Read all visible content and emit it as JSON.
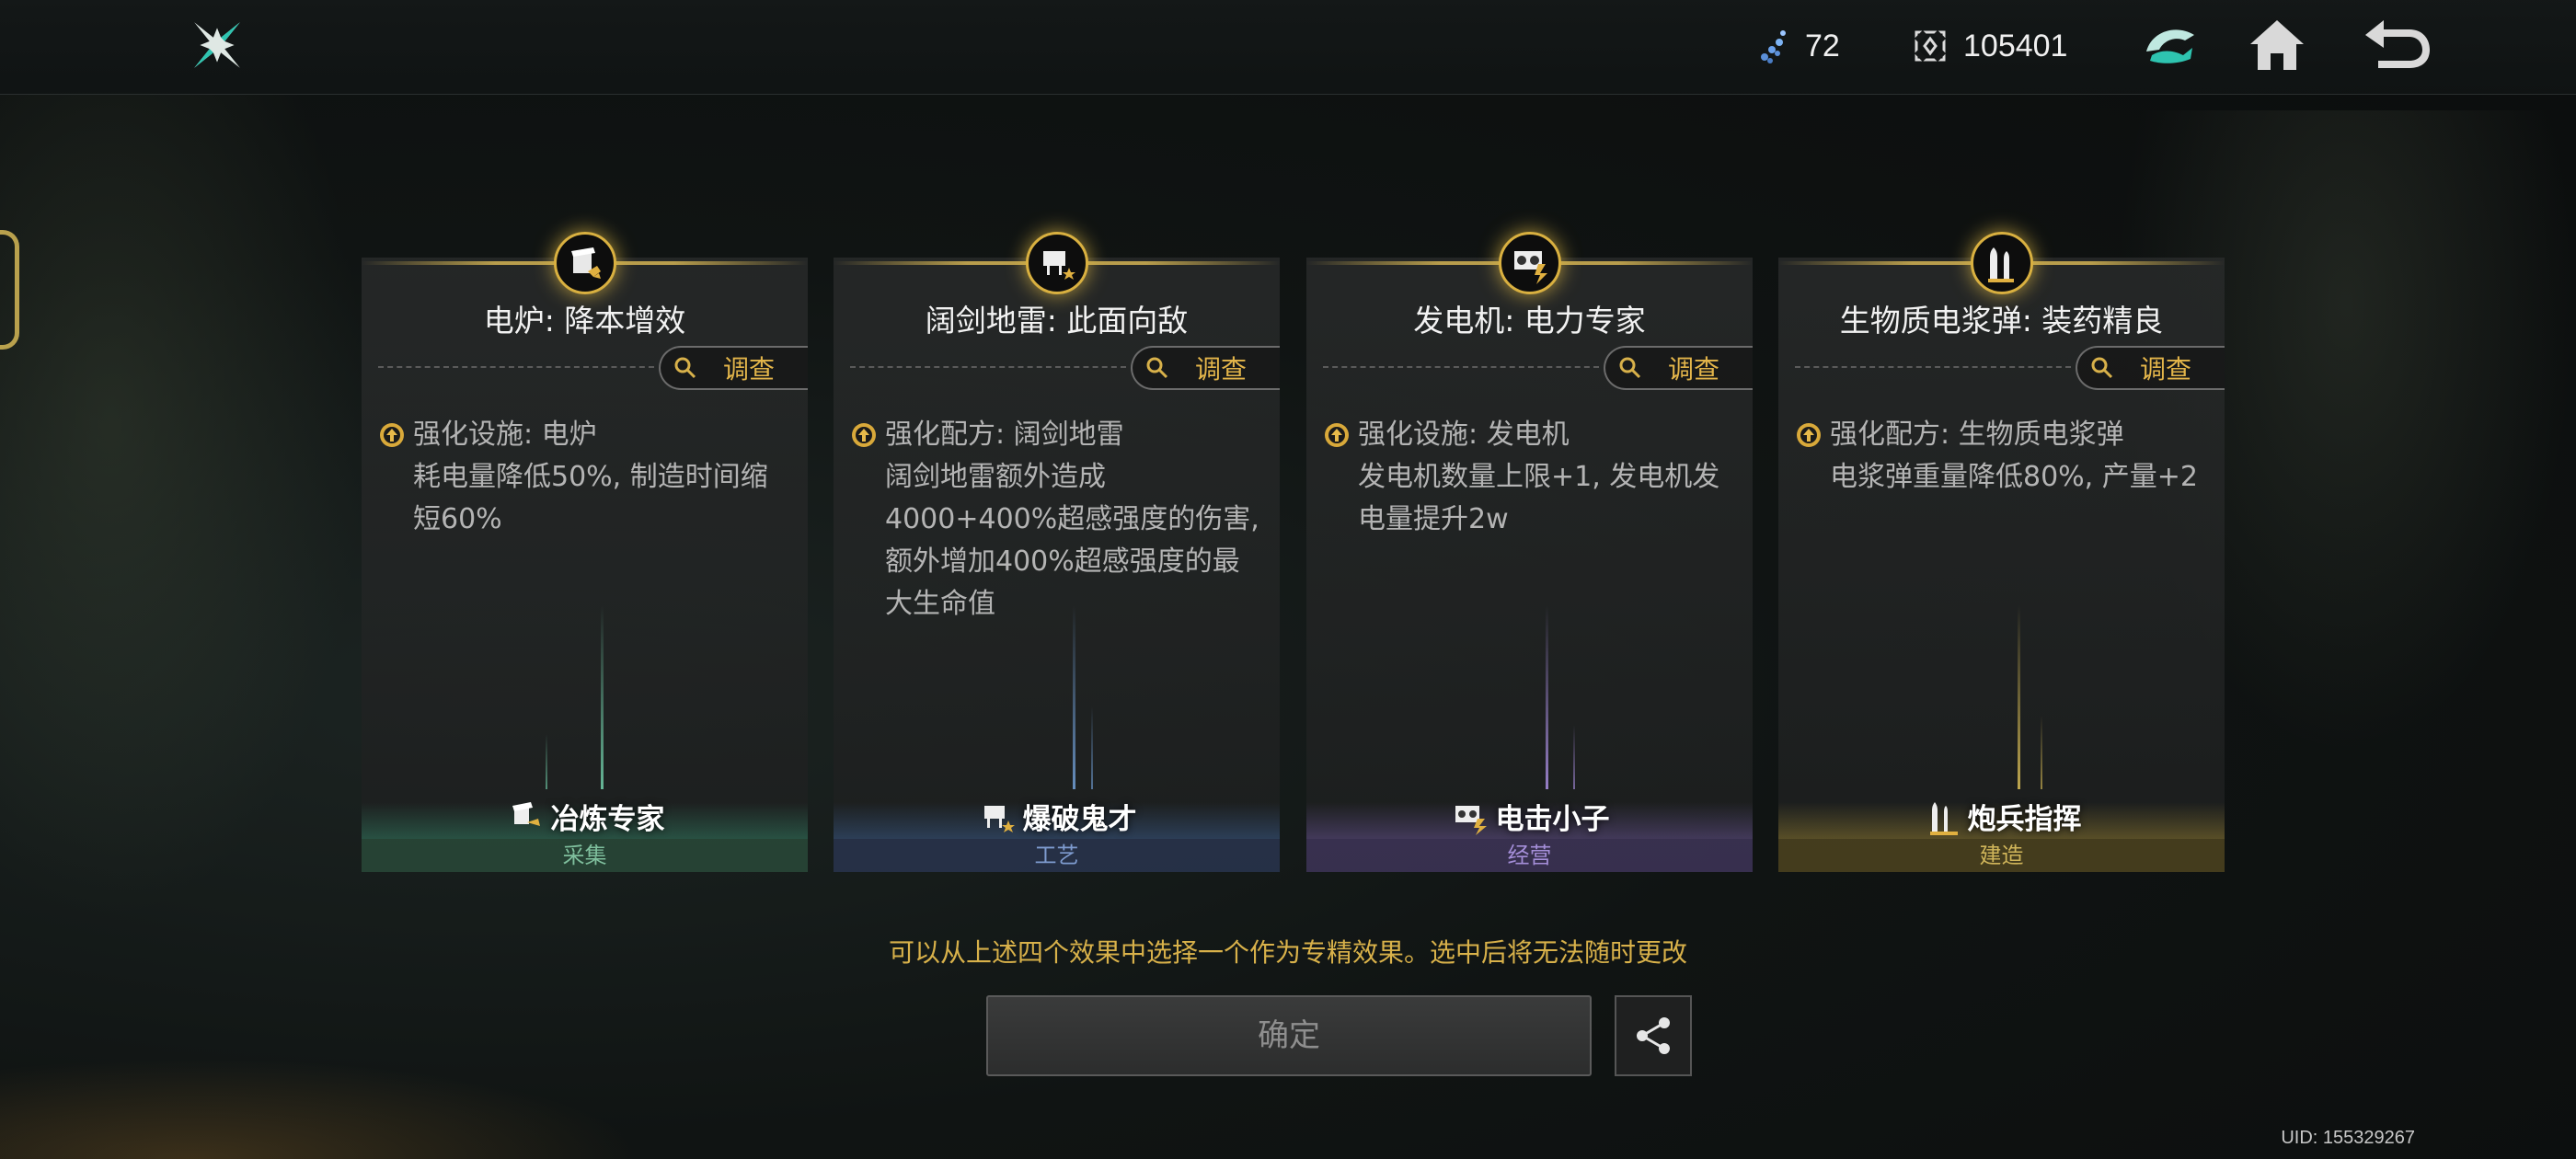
{
  "topbar": {
    "energy_icon": "energy-crystal-icon",
    "energy": "72",
    "coin_icon": "currency-icon",
    "coins": "105401",
    "buttons": [
      "helmet-icon",
      "home-icon",
      "back-arrow-icon"
    ]
  },
  "cards": [
    {
      "title": "电炉: 降本增效",
      "investigate": "调查",
      "effect_line1": "强化设施: 电炉",
      "effect_rest": "耗电量降低50%, 制造时间缩短60%",
      "specialist": "冶炼专家",
      "category": "采集",
      "accent": "#3fae86"
    },
    {
      "title": "阔剑地雷: 此面向敌",
      "investigate": "调查",
      "effect_line1": "强化配方: 阔剑地雷",
      "effect_rest": "阔剑地雷额外造成4000+400%超感强度的伤害, 额外增加400%超感强度的最大生命值",
      "specialist": "爆破鬼才",
      "category": "工艺",
      "accent": "#4a7ac0"
    },
    {
      "title": "发电机: 电力专家",
      "investigate": "调查",
      "effect_line1": "强化设施: 发电机",
      "effect_rest": "发电机数量上限+1, 发电机发电量提升2w",
      "specialist": "电击小子",
      "category": "经营",
      "accent": "#8a6cc8"
    },
    {
      "title": "生物质电浆弹: 装药精良",
      "investigate": "调查",
      "effect_line1": "强化配方: 生物质电浆弹",
      "effect_rest": "电浆弹重量降低80%, 产量+2",
      "specialist": "炮兵指挥",
      "category": "建造",
      "accent": "#c9a93a"
    }
  ],
  "hint": "可以从上述四个效果中选择一个作为专精效果。选中后将无法随时更改",
  "confirm_label": "确定",
  "uid": "UID: 155329267"
}
